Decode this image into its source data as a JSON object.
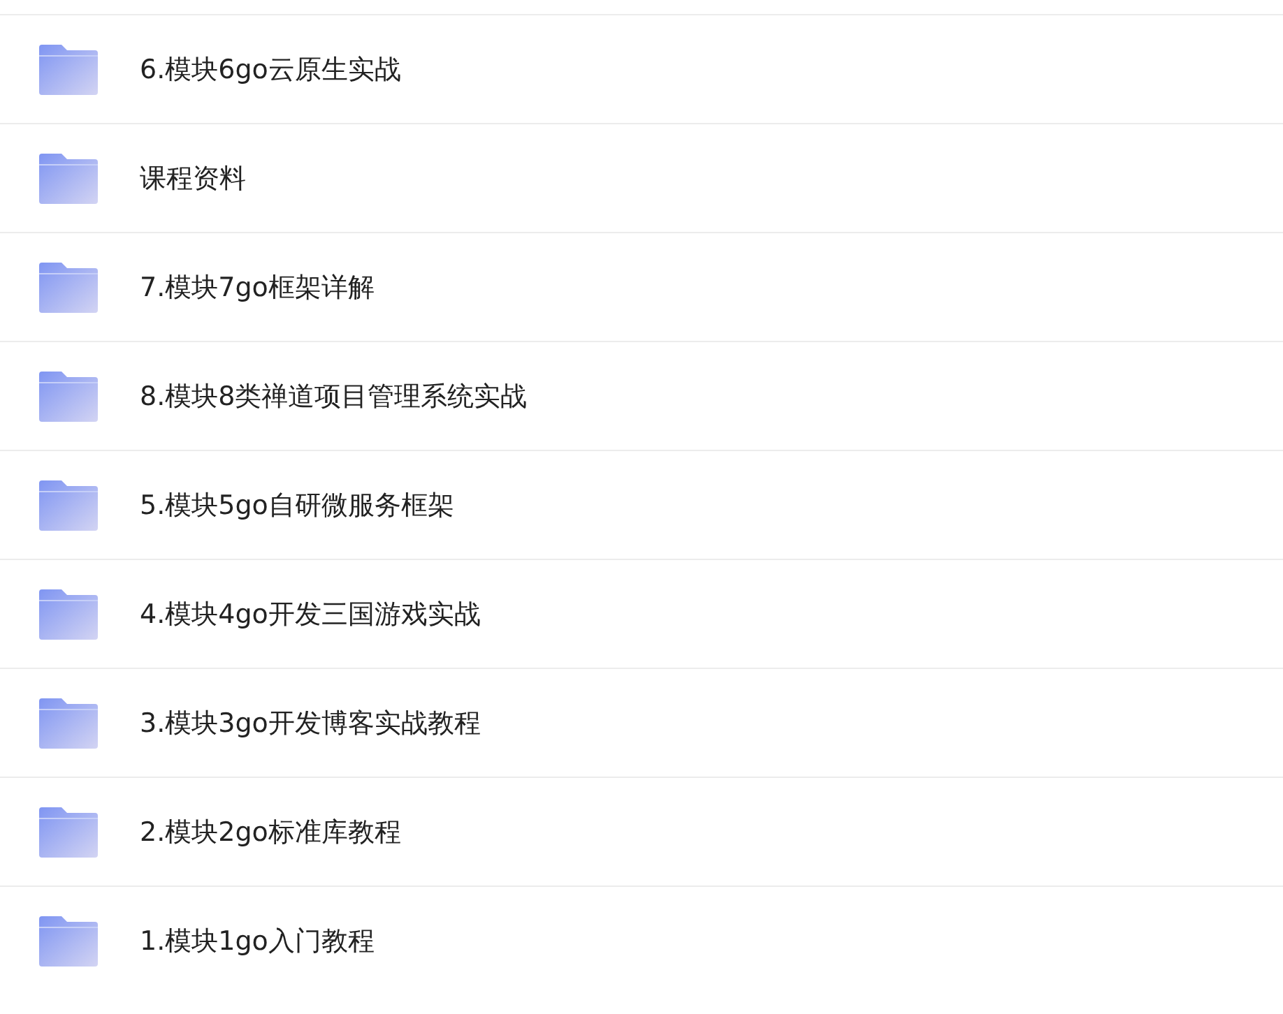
{
  "folders": [
    {
      "name": "6.模块6go云原生实战"
    },
    {
      "name": "课程资料"
    },
    {
      "name": "7.模块7go框架详解"
    },
    {
      "name": "8.模块8类禅道项目管理系统实战"
    },
    {
      "name": "5.模块5go自研微服务框架"
    },
    {
      "name": "4.模块4go开发三国游戏实战"
    },
    {
      "name": "3.模块3go开发博客实战教程"
    },
    {
      "name": "2.模块2go标准库教程"
    },
    {
      "name": "1.模块1go入门教程"
    }
  ]
}
